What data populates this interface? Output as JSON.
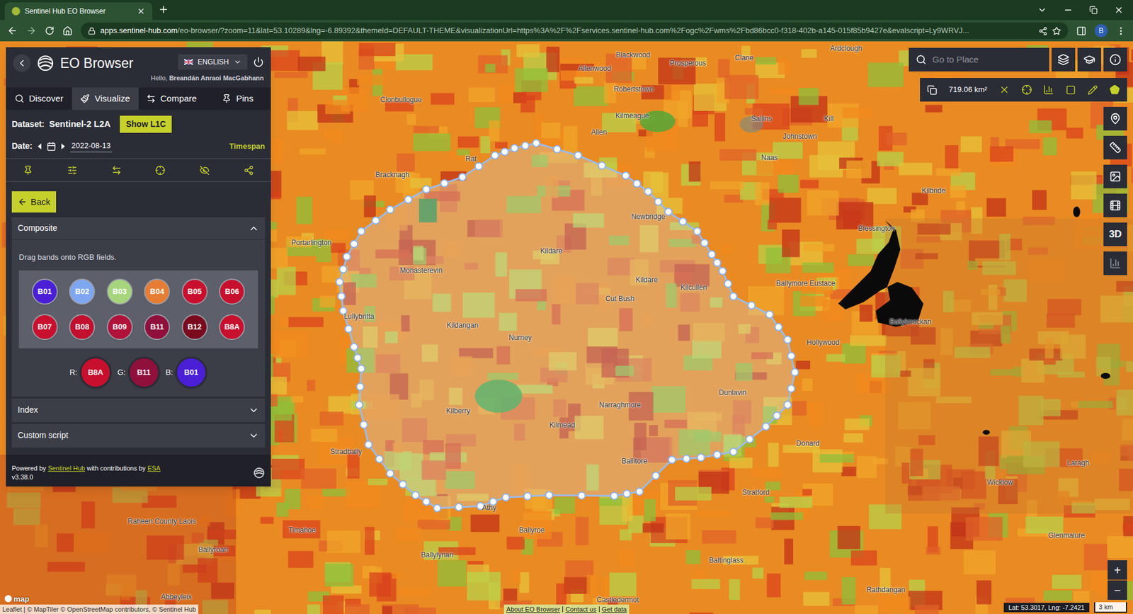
{
  "browser": {
    "tab_title": "Sentinel Hub EO Browser",
    "url_host": "apps.sentinel-hub.com",
    "url_path": "/eo-browser/?zoom=11&lat=53.10289&lng=-6.89392&themeId=DEFAULT-THEME&visualizationUrl=https%3A%2F%2Fservices.sentinel-hub.com%2Fogc%2Fwms%2Fbd86bcc0-f318-402b-a145-015f85b9427e&evalscript=Ly9WRVJ...",
    "avatar": "B"
  },
  "app": {
    "title": "EO Browser",
    "language": "ENGLISH",
    "greeting": "Hello, ",
    "user": "Breandán Anraoi MacGabhann"
  },
  "tabs": [
    {
      "label": "Discover",
      "selected": false
    },
    {
      "label": "Visualize",
      "selected": true
    },
    {
      "label": "Compare",
      "selected": false
    },
    {
      "label": "Pins",
      "selected": false
    }
  ],
  "dataset": {
    "label": "Dataset:",
    "value": "Sentinel-2 L2A",
    "button": "Show L1C"
  },
  "date": {
    "label": "Date:",
    "value": "2022-08-13",
    "timespan": "Timespan"
  },
  "back_button": "Back",
  "sections": [
    {
      "title": "Composite",
      "expanded": true
    },
    {
      "title": "Index",
      "expanded": false
    },
    {
      "title": "Custom script",
      "expanded": false
    }
  ],
  "composite": {
    "hint": "Drag bands onto RGB fields.",
    "bands": [
      {
        "label": "B01",
        "color": "#4a1fd6"
      },
      {
        "label": "B02",
        "color": "#7fa6f0"
      },
      {
        "label": "B03",
        "color": "#a6d57e"
      },
      {
        "label": "B04",
        "color": "#e67d34"
      },
      {
        "label": "B05",
        "color": "#c8102e"
      },
      {
        "label": "B06",
        "color": "#c8102e"
      },
      {
        "label": "B07",
        "color": "#c8102e"
      },
      {
        "label": "B08",
        "color": "#c2102f"
      },
      {
        "label": "B09",
        "color": "#b0123a"
      },
      {
        "label": "B11",
        "color": "#90103c"
      },
      {
        "label": "B12",
        "color": "#7a0a1e"
      },
      {
        "label": "B8A",
        "color": "#c8102e"
      }
    ],
    "rgb": [
      {
        "channel": "R:",
        "band": "B8A",
        "color": "#c8102e"
      },
      {
        "channel": "G:",
        "band": "B11",
        "color": "#90103c"
      },
      {
        "channel": "B:",
        "band": "B01",
        "color": "#4a1fd6"
      }
    ]
  },
  "footer": {
    "powered": "Powered by ",
    "sentinel_hub": "Sentinel Hub",
    "contrib": " with contributions by ",
    "esa": "ESA",
    "version": "v3.38.0"
  },
  "search": {
    "placeholder": "Go to Place"
  },
  "measure_area": "719.06 km²",
  "three_d": "3D",
  "zoom": {
    "in": "+",
    "out": "−"
  },
  "maptiler": "map",
  "attribution": "Leaflet | © MapTiler © OpenStreetMap contributors, © Sentinel Hub",
  "links": [
    "About EO Browser",
    "Contact us",
    "Get data"
  ],
  "coords": "Lat: 53.3017, Lng: -7.2421",
  "scale": "3 km",
  "map_labels": [
    "Blackwood",
    "Allenwood",
    "Prosperous",
    "Clane",
    "Ardclough",
    "Robertstown",
    "Kilmeague",
    "Allen",
    "Sallins",
    "Kill",
    "Johnstown",
    "Naas",
    "Clonbullogue",
    "Rat",
    "Bracknagh",
    "Newbridge",
    "Portarlington",
    "Kildare",
    "Monasterevin",
    "Kildare",
    "Cut Bush",
    "Kilcullen",
    "Ballymore Eustace",
    "Blessington",
    "Kilbride",
    "Ballyknockan",
    "Hollywood",
    "Lullybritta",
    "Kildangan",
    "Nurney",
    "Dunlavin",
    "Kilberry",
    "Narraghmore",
    "Kilmead",
    "Donard",
    "Ballitore",
    "Stradbally",
    "Athy",
    "Stratford",
    "Laragh",
    "Wicklow",
    "Timahoe",
    "Raheen County Laois",
    "Ballyroe",
    "Glenmalure",
    "Ballyroan",
    "Ballylynan",
    "Baltinglass",
    "Rathdangan",
    "Abbeyleix",
    "Castledermot"
  ]
}
